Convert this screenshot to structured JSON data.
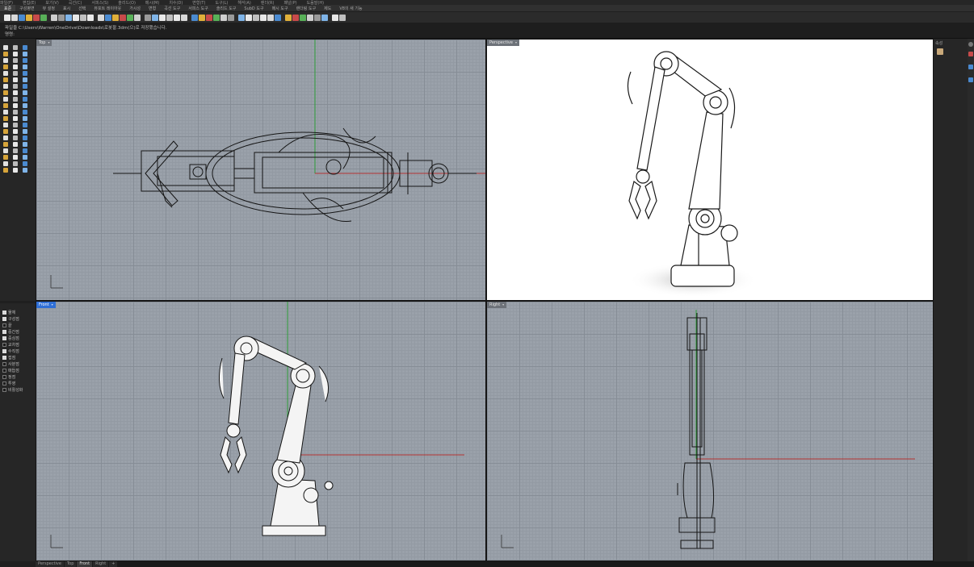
{
  "menubar": {
    "items": [
      "파일(F)",
      "편집(E)",
      "보기(V)",
      "곡선(C)",
      "서피스(S)",
      "솔리드(O)",
      "메시(M)",
      "치수(D)",
      "변형(T)",
      "도구(L)",
      "해석(A)",
      "렌더(R)",
      "패널(P)",
      "도움말(H)"
    ]
  },
  "tabs": [
    "표준",
    "구성평면",
    "뷰 설정",
    "표시",
    "선택",
    "뷰포트 레이아웃",
    "가시성",
    "변형",
    "곡선 도구",
    "서피스 도구",
    "솔리드 도구",
    "SubD 도구",
    "메시 도구",
    "렌더링 도구",
    "제도",
    "V8의 새 기능"
  ],
  "toolbar": {
    "icon_count": 44
  },
  "command": {
    "history_line": "파일을 C:\\Users\\Warren\\OneDrive\\Downloads\\로봇팔.3dm(으)로 저장했습니다.",
    "prompt_line": "명령:"
  },
  "viewports": {
    "top": {
      "label": "Top"
    },
    "perspective": {
      "label": "Perspective"
    },
    "front": {
      "label": "Front"
    },
    "right": {
      "label": "Right"
    }
  },
  "layers": [
    {
      "name": "물체",
      "checked": true
    },
    {
      "name": "구성점",
      "checked": true
    },
    {
      "name": "끝",
      "checked": false
    },
    {
      "name": "중간점",
      "checked": true
    },
    {
      "name": "중심점",
      "checked": true
    },
    {
      "name": "교차점",
      "checked": false
    },
    {
      "name": "수직점",
      "checked": true
    },
    {
      "name": "접점",
      "checked": true
    },
    {
      "name": "사분점",
      "checked": false
    },
    {
      "name": "매듭점",
      "checked": false
    },
    {
      "name": "정점",
      "checked": false
    },
    {
      "name": "투영",
      "checked": false
    },
    {
      "name": "비활성화",
      "checked": false
    }
  ],
  "rightpanel": {
    "title": "속성"
  },
  "bottom_tabs": [
    "Perspective",
    "Top",
    "Front",
    "Right"
  ],
  "colors": {
    "active_tab": "#2f6fd6",
    "viewport_bg": "#9aa1aa",
    "perspective_bg": "#ffffff",
    "x_axis": "#b33333",
    "y_axis": "#2f9d3a"
  }
}
